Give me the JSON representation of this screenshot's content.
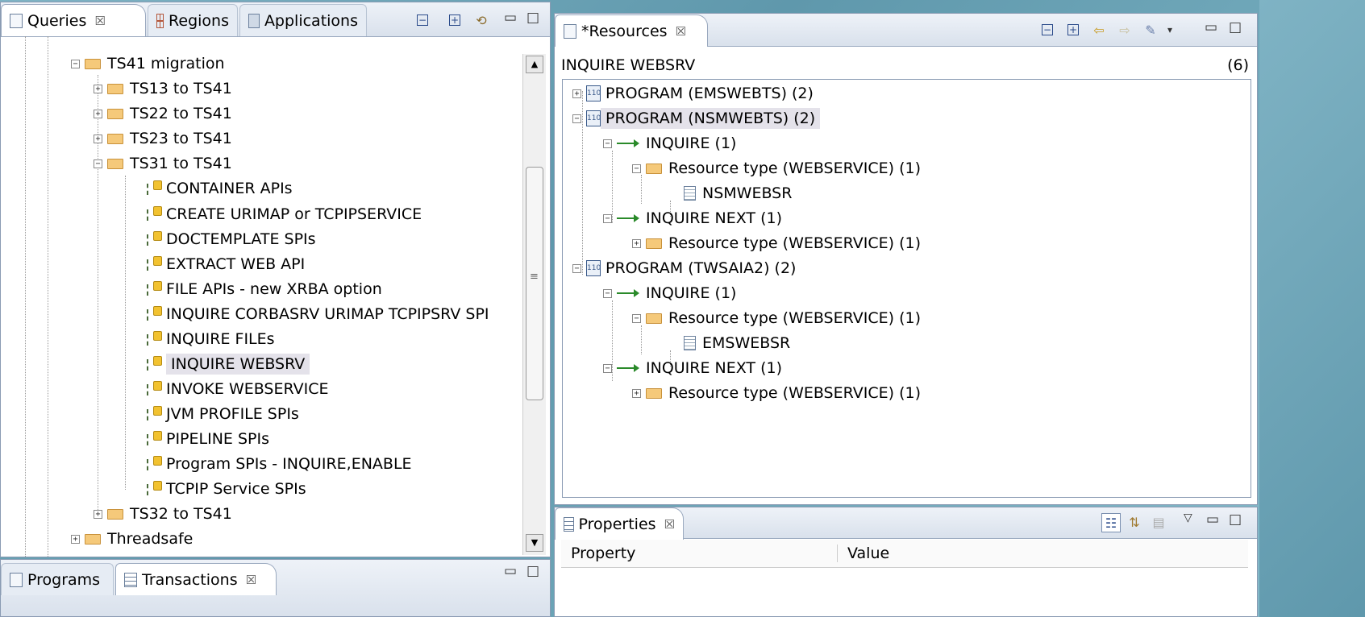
{
  "left_panel": {
    "tabs": [
      {
        "label": "Queries",
        "icon": "page-icon",
        "close": "☒"
      },
      {
        "label": "Regions",
        "icon": "regions-icon"
      },
      {
        "label": "Applications",
        "icon": "applications-icon"
      }
    ],
    "tree": [
      {
        "label": "TS41 migration",
        "type": "folder",
        "expander": "−"
      },
      {
        "label": "TS13 to TS41",
        "type": "folder",
        "expander": "+"
      },
      {
        "label": "TS22 to TS41",
        "type": "folder",
        "expander": "+"
      },
      {
        "label": "TS23 to TS41",
        "type": "folder",
        "expander": "+"
      },
      {
        "label": "TS31 to TS41",
        "type": "folder",
        "expander": "−"
      },
      {
        "label": "CONTAINER APIs",
        "type": "query"
      },
      {
        "label": "CREATE URIMAP or TCPIPSERVICE",
        "type": "query"
      },
      {
        "label": "DOCTEMPLATE SPIs",
        "type": "query"
      },
      {
        "label": "EXTRACT WEB API",
        "type": "query"
      },
      {
        "label": "FILE APIs - new XRBA option",
        "type": "query"
      },
      {
        "label": "INQUIRE CORBASRV URIMAP TCPIPSRV SPI",
        "type": "query"
      },
      {
        "label": "INQUIRE FILEs",
        "type": "query"
      },
      {
        "label": "INQUIRE WEBSRV",
        "type": "query",
        "selected": true
      },
      {
        "label": "INVOKE WEBSERVICE",
        "type": "query"
      },
      {
        "label": "JVM PROFILE SPIs",
        "type": "query"
      },
      {
        "label": "PIPELINE SPIs",
        "type": "query"
      },
      {
        "label": "Program SPIs - INQUIRE,ENABLE",
        "type": "query"
      },
      {
        "label": "TCPIP Service SPIs",
        "type": "query"
      },
      {
        "label": "TS32 to TS41",
        "type": "folder",
        "expander": "+"
      },
      {
        "label": "Threadsafe",
        "type": "folder",
        "expander": "+"
      }
    ]
  },
  "bottom_left_tabs": [
    {
      "label": "Programs"
    },
    {
      "label": "Transactions",
      "close": "☒"
    }
  ],
  "resources_panel": {
    "tab": {
      "label": "*Resources",
      "close": "☒"
    },
    "header_title": "INQUIRE WEBSRV",
    "header_count": "(6)",
    "tree": [
      {
        "label": "PROGRAM (EMSWEBTS)  (2)",
        "type": "program",
        "expander": "+"
      },
      {
        "label": "PROGRAM (NSMWEBTS)  (2)",
        "type": "program",
        "expander": "−",
        "selected": true
      },
      {
        "label": "INQUIRE  (1)",
        "type": "arrow",
        "expander": "−"
      },
      {
        "label": "Resource type (WEBSERVICE)  (1)",
        "type": "folder",
        "expander": "−"
      },
      {
        "label": "NSMWEBSR",
        "type": "doc"
      },
      {
        "label": "INQUIRE NEXT  (1)",
        "type": "arrow",
        "expander": "−"
      },
      {
        "label": "Resource type (WEBSERVICE)  (1)",
        "type": "folder",
        "expander": "+"
      },
      {
        "label": "PROGRAM (TWSAIA2)  (2)",
        "type": "program",
        "expander": "−"
      },
      {
        "label": "INQUIRE  (1)",
        "type": "arrow",
        "expander": "−"
      },
      {
        "label": "Resource type (WEBSERVICE)  (1)",
        "type": "folder",
        "expander": "−"
      },
      {
        "label": "EMSWEBSR",
        "type": "doc"
      },
      {
        "label": "INQUIRE NEXT  (1)",
        "type": "arrow",
        "expander": "−"
      },
      {
        "label": "Resource type (WEBSERVICE)  (1)",
        "type": "folder",
        "expander": "+"
      }
    ]
  },
  "properties_panel": {
    "tab": {
      "label": "Properties",
      "close": "☒"
    },
    "columns": [
      "Property",
      "Value"
    ]
  },
  "icons": {
    "minimize": "▭",
    "maximize": "□",
    "collapse_all": "⊟",
    "expand_all": "⊞",
    "back": "⇦",
    "forward": "⇨",
    "menu": "▾",
    "scroll_up": "▲",
    "scroll_down": "▼",
    "grip": "≡",
    "view_menu": "▽"
  }
}
